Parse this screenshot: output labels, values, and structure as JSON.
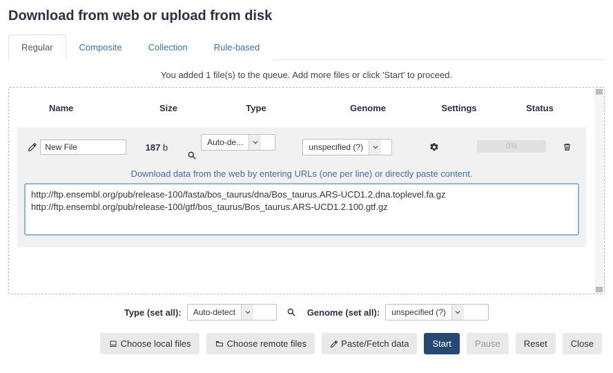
{
  "title": "Download from web or upload from disk",
  "tabs": {
    "regular": "Regular",
    "composite": "Composite",
    "collection": "Collection",
    "rulebased": "Rule-based"
  },
  "activeTab": "regular",
  "queueMsg": "You added 1 file(s) to the queue. Add more files or click 'Start' to proceed.",
  "columns": {
    "name": "Name",
    "size": "Size",
    "type": "Type",
    "genome": "Genome",
    "settings": "Settings",
    "status": "Status"
  },
  "file": {
    "name": "New File",
    "sizeValue": "187",
    "sizeUnit": " b",
    "type": "Auto-de...",
    "genome": "unspecified (?)",
    "progress": "0%"
  },
  "hint": "Download data from the web by entering URLs (one per line) or directly paste content.",
  "urlContent": "http://ftp.ensembl.org/pub/release-100/fasta/bos_taurus/dna/Bos_taurus.ARS-UCD1.2.dna.toplevel.fa.gz\nhttp://ftp.ensembl.org/pub/release-100/gtf/bos_taurus/Bos_taurus.ARS-UCD1.2.100.gtf.gz",
  "setAll": {
    "typeLabel": "Type (set all):",
    "typeValue": "Auto-detect",
    "genomeLabel": "Genome (set all):",
    "genomeValue": "unspecified (?)"
  },
  "actions": {
    "chooseLocal": "Choose local files",
    "chooseRemote": "Choose remote files",
    "pasteFetch": "Paste/Fetch data",
    "start": "Start",
    "pause": "Pause",
    "reset": "Reset",
    "close": "Close"
  }
}
